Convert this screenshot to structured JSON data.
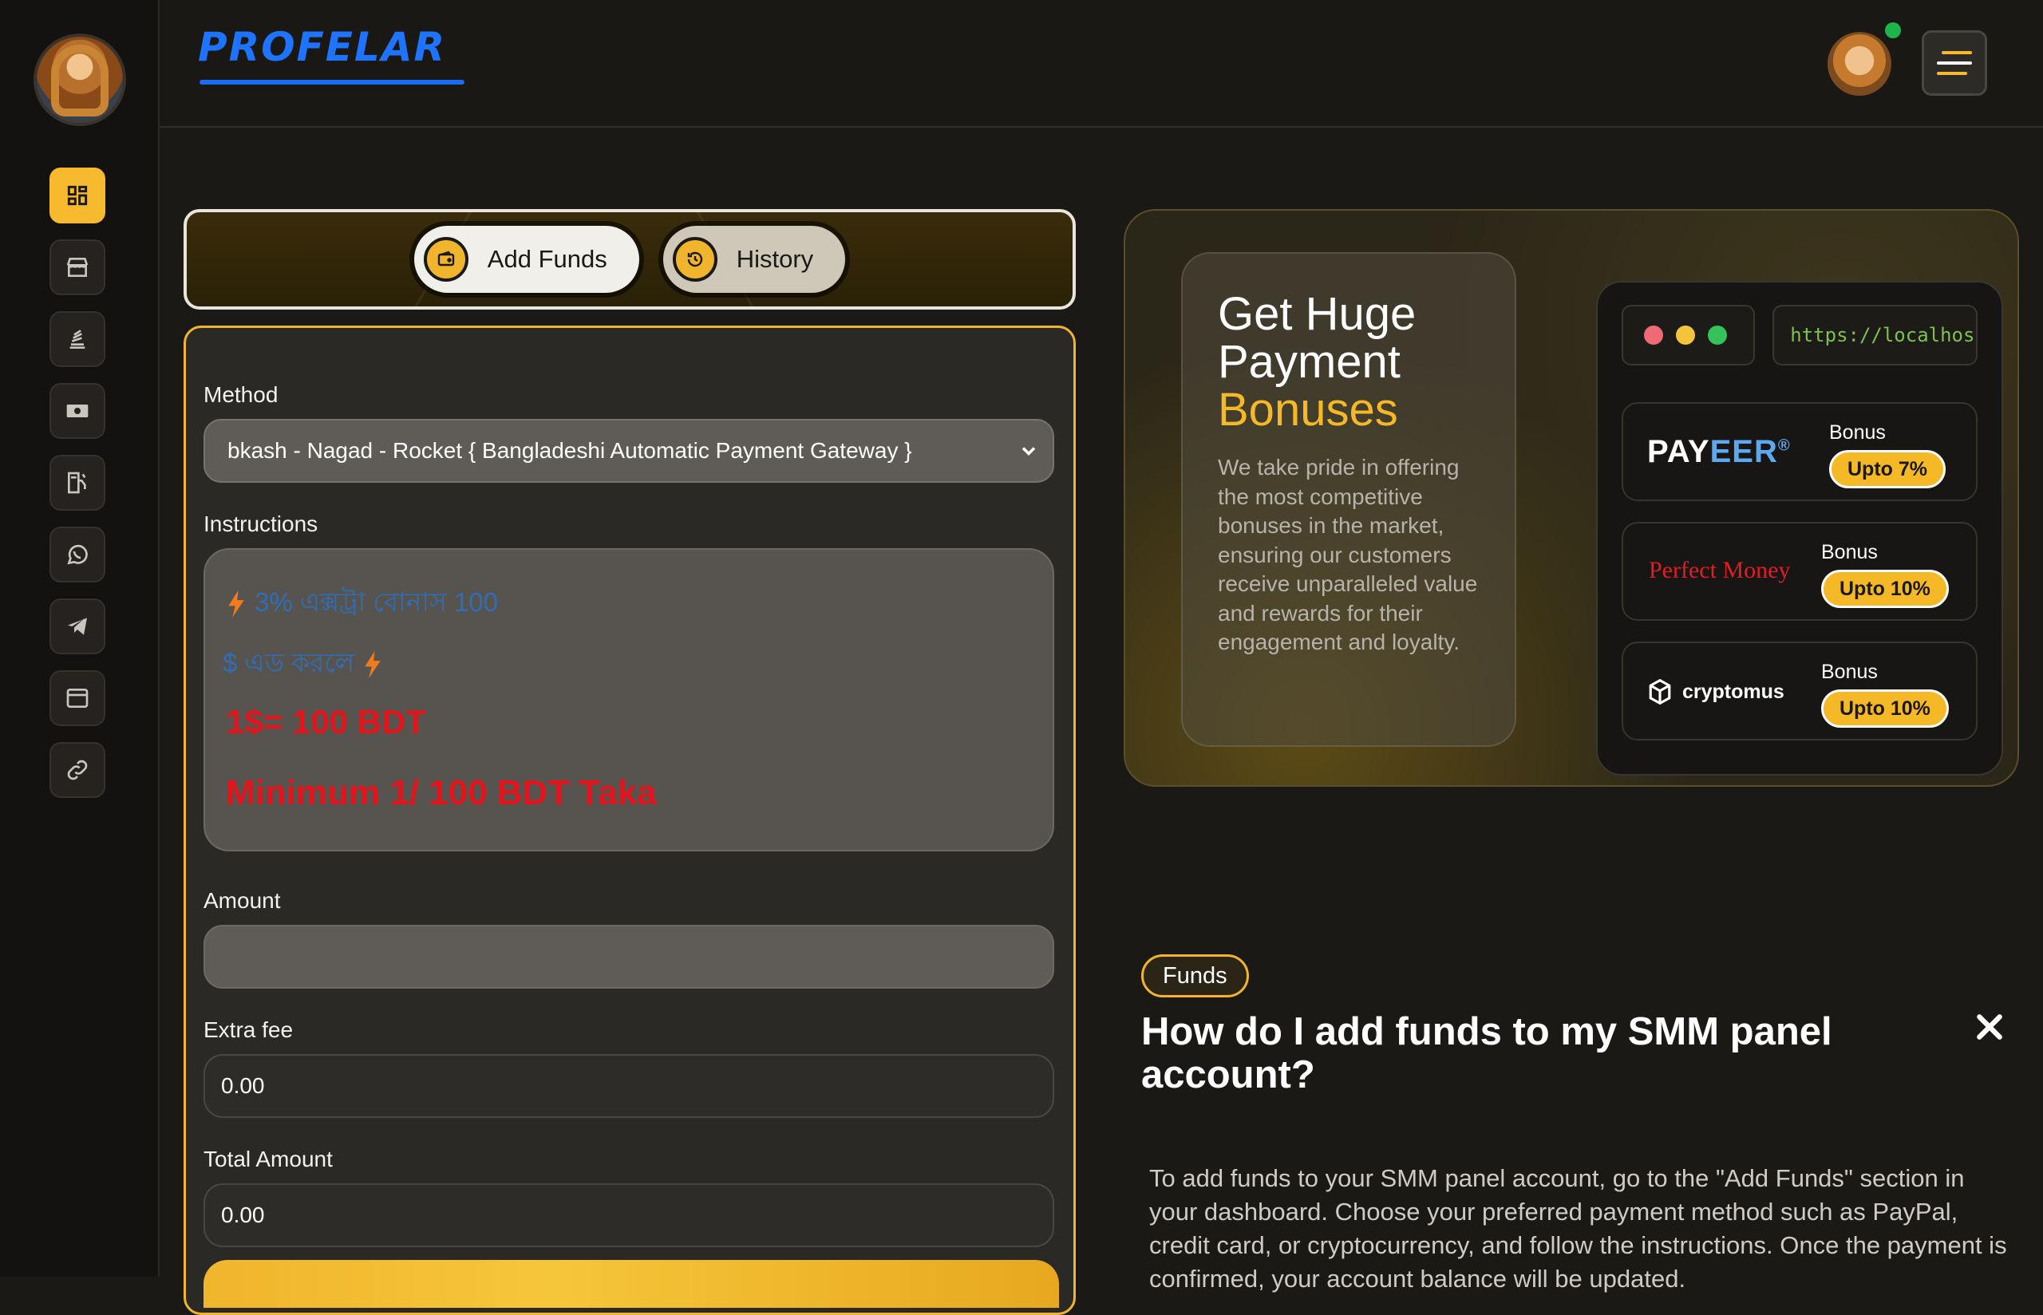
{
  "brand": {
    "name": "PROFELAR",
    "color": "#1f74ff",
    "accent": "#f5b928"
  },
  "sidebar": {
    "items": [
      {
        "name": "dashboard",
        "icon": "grid-icon",
        "active": true
      },
      {
        "name": "store",
        "icon": "store-icon",
        "active": false
      },
      {
        "name": "orders",
        "icon": "stack-icon",
        "active": false
      },
      {
        "name": "funds",
        "icon": "money-icon",
        "active": false
      },
      {
        "name": "refill",
        "icon": "fuel-icon",
        "active": false
      },
      {
        "name": "whatsapp",
        "icon": "whatsapp-icon",
        "active": false
      },
      {
        "name": "telegram",
        "icon": "telegram-icon",
        "active": false
      },
      {
        "name": "browser",
        "icon": "window-icon",
        "active": false
      },
      {
        "name": "links",
        "icon": "link-icon",
        "active": false
      }
    ]
  },
  "tabs": [
    {
      "label": "Add Funds",
      "icon": "wallet-icon",
      "active": true
    },
    {
      "label": "History",
      "icon": "history-icon",
      "active": false
    }
  ],
  "form": {
    "method_label": "Method",
    "method_value": "bkash - Nagad - Rocket { Bangladeshi Automatic Payment Gateway }",
    "instructions_label": "Instructions",
    "instructions": {
      "line1": "3% এক্সট্রা বোনাস 100",
      "line2": "$ এড করলে",
      "rate": "1$= 100 BDT",
      "minimum": "Minimum 1/ 100 BDT Taka"
    },
    "amount_label": "Amount",
    "amount_value": "",
    "extra_fee_label": "Extra fee",
    "extra_fee_value": "0.00",
    "total_label": "Total Amount",
    "total_value": "0.00"
  },
  "promo": {
    "title_line1": "Get Huge",
    "title_line2": "Payment",
    "title_highlight": "Bonuses",
    "description": "We take pride in offering the most competitive bonuses in the market, ensuring our customers receive unparalleled value and rewards for their engagement and loyalty.",
    "url": "https://localhost/b",
    "methods": [
      {
        "name": "PAYEER",
        "bonus_label": "Bonus",
        "bonus_value": "Upto 7%"
      },
      {
        "name": "Perfect Money",
        "bonus_label": "Bonus",
        "bonus_value": "Upto 10%"
      },
      {
        "name": "cryptomus",
        "bonus_label": "Bonus",
        "bonus_value": "Upto 10%"
      }
    ]
  },
  "faq": {
    "tag": "Funds",
    "question": "How do I add funds to my SMM panel account?",
    "answer": "To add funds to your SMM panel account, go to the \"Add Funds\" section in your dashboard. Choose your preferred payment method such as PayPal, credit card, or cryptocurrency, and follow the instructions. Once the payment is confirmed, your account balance will be updated."
  }
}
